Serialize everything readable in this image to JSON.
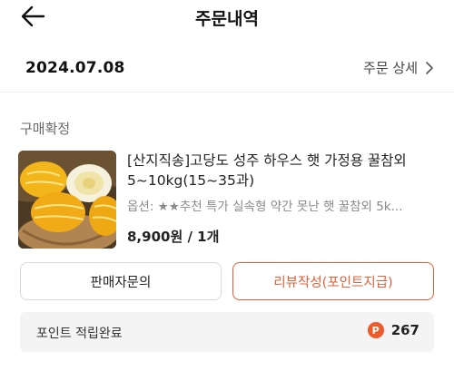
{
  "header": {
    "title": "주문내역",
    "back_icon": "arrow-left-icon"
  },
  "order": {
    "date": "2024.07.08",
    "detail_label": "주문 상세"
  },
  "status": "구매확정",
  "product": {
    "title": "[산지직송]고당도 성주 하우스 햇 가정용 꿀참외 5~10kg(15~35과)",
    "option": "옵션: ★★추천 특가 실속형 약간 못난 햇 꿀참외 5k...",
    "price_qty": "8,900원 / 1개"
  },
  "buttons": {
    "inquiry": "판매자문의",
    "review": "리뷰작성(포인트지급)"
  },
  "points": {
    "label": "포인트 적립완료",
    "badge": "P",
    "value": "267"
  },
  "colors": {
    "accent": "#e0603a",
    "badge": "#ef5a2a"
  }
}
